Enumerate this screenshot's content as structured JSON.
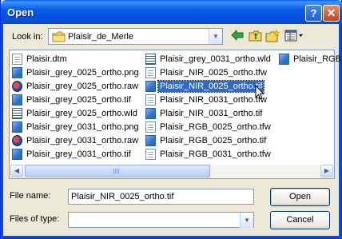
{
  "window": {
    "title": "Open",
    "help_glyph": "?",
    "close_glyph": "✕"
  },
  "lookin": {
    "label": "Look in:",
    "value": "Plaisir_de_Merle",
    "icon": "folder-icon"
  },
  "toolbar": {
    "icons": [
      "back-arrow-icon",
      "up-folder-icon",
      "new-folder-icon",
      "view-menu-icon"
    ]
  },
  "files": [
    {
      "name": "Plaisir.dtm",
      "icon": "document-icon"
    },
    {
      "name": "Plaisir_grey_0025_ortho.png",
      "icon": "image-icon"
    },
    {
      "name": "Plaisir_grey_0025_ortho.raw",
      "icon": "raw-icon"
    },
    {
      "name": "Plaisir_grey_0025_ortho.tif",
      "icon": "image-icon"
    },
    {
      "name": "Plaisir_grey_0025_ortho.wld",
      "icon": "grid-icon"
    },
    {
      "name": "Plaisir_grey_0031_ortho.png",
      "icon": "image-icon"
    },
    {
      "name": "Plaisir_grey_0031_ortho.raw",
      "icon": "raw-icon"
    },
    {
      "name": "Plaisir_grey_0031_ortho.tif",
      "icon": "image-icon"
    },
    {
      "name": "Plaisir_grey_0031_ortho.wld",
      "icon": "grid-icon"
    },
    {
      "name": "Plaisir_NIR_0025_ortho.tfw",
      "icon": "document-icon"
    },
    {
      "name": "Plaisir_NIR_0025_ortho.tif",
      "icon": "image-icon",
      "selected": true
    },
    {
      "name": "Plaisir_NIR_0031_ortho.tfw",
      "icon": "document-icon"
    },
    {
      "name": "Plaisir_NIR_0031_ortho.tif",
      "icon": "image-icon"
    },
    {
      "name": "Plaisir_RGB_0025_ortho.tfw",
      "icon": "document-icon"
    },
    {
      "name": "Plaisir_RGB_0025_ortho.tif",
      "icon": "image-icon"
    },
    {
      "name": "Plaisir_RGB_0031_ortho.tfw",
      "icon": "document-icon"
    },
    {
      "name": "Plaisir_RGB",
      "icon": "image-icon"
    }
  ],
  "filename": {
    "label": "File name:",
    "value": "Plaisir_NIR_0025_ortho.tif"
  },
  "filetype": {
    "label": "Files of type:",
    "value": ""
  },
  "buttons": {
    "open": "Open",
    "cancel": "Cancel"
  },
  "colors": {
    "titlebar": "#0053e6",
    "selection": "#316ac5",
    "dialog_bg": "#ece9d8"
  }
}
